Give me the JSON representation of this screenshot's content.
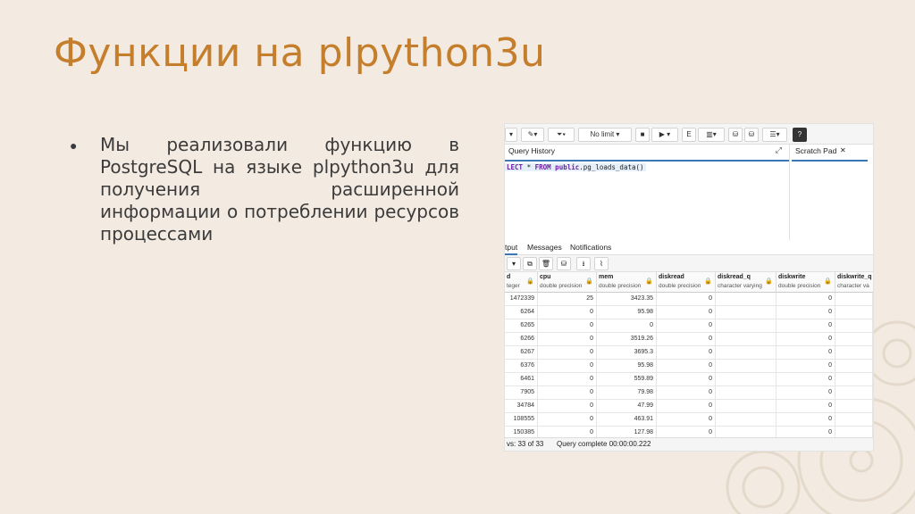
{
  "slide": {
    "title": "Функции на plpython3u",
    "bullet": "Мы реализовали функцию в PostgreSQL на языке plpython3u для получения расширенной информации о потреблении ресурсов процессами"
  },
  "screenshot": {
    "toolbar": {
      "limit_label": "No limit"
    },
    "query_history_label": "Query History",
    "scratch_pad_label": "Scratch Pad",
    "sql": {
      "kw1": "LECT",
      "star": " * ",
      "kw2": "FROM",
      "rest_kw": " public",
      "rest": ".pg_loads_data()"
    },
    "output_tabs": [
      "tput",
      "Messages",
      "Notifications"
    ],
    "columns": [
      {
        "name": "d",
        "type": "teger"
      },
      {
        "name": "cpu",
        "type": "double precision"
      },
      {
        "name": "mem",
        "type": "double precision"
      },
      {
        "name": "diskread",
        "type": "double precision"
      },
      {
        "name": "diskread_q",
        "type": "character varying"
      },
      {
        "name": "diskwrite",
        "type": "double precision"
      },
      {
        "name": "diskwrite_q",
        "type": "character va"
      }
    ],
    "rows": [
      [
        "1472339",
        "25",
        "3423.35",
        "0",
        "",
        "0",
        ""
      ],
      [
        "6264",
        "0",
        "95.98",
        "0",
        "",
        "0",
        ""
      ],
      [
        "6265",
        "0",
        "0",
        "0",
        "",
        "0",
        ""
      ],
      [
        "6266",
        "0",
        "3519.26",
        "0",
        "",
        "0",
        ""
      ],
      [
        "6267",
        "0",
        "3695.3",
        "0",
        "",
        "0",
        ""
      ],
      [
        "6376",
        "0",
        "95.98",
        "0",
        "",
        "0",
        ""
      ],
      [
        "6461",
        "0",
        "559.89",
        "0",
        "",
        "0",
        ""
      ],
      [
        "7905",
        "0",
        "79.98",
        "0",
        "",
        "0",
        ""
      ],
      [
        "34784",
        "0",
        "47.99",
        "0",
        "",
        "0",
        ""
      ],
      [
        "108555",
        "0",
        "463.91",
        "0",
        "",
        "0",
        ""
      ],
      [
        "150385",
        "0",
        "127.98",
        "0",
        "",
        "0",
        ""
      ]
    ],
    "status": {
      "rows_label": "vs: 33 of 33",
      "query_label": "Query complete 00:00:00.222"
    }
  }
}
